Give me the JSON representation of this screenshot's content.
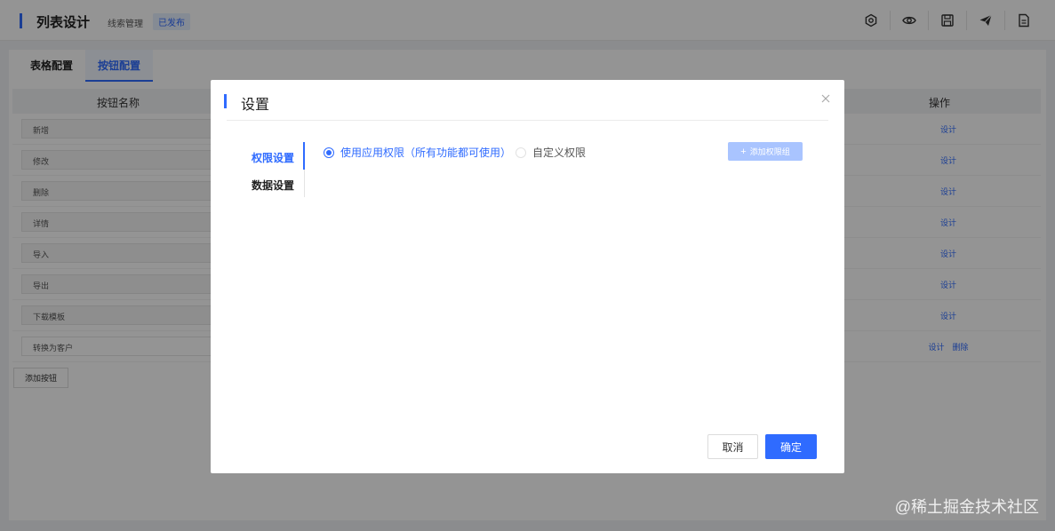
{
  "header": {
    "title": "列表设计",
    "breadcrumb": "线索管理",
    "status": "已发布",
    "tools": [
      {
        "icon": "settings-icon"
      },
      {
        "icon": "eye-icon"
      },
      {
        "icon": "save-icon"
      },
      {
        "icon": "send-icon"
      },
      {
        "icon": "document-icon"
      }
    ]
  },
  "tabs": [
    {
      "label": "表格配置",
      "active": false
    },
    {
      "label": "按钮配置",
      "active": true
    }
  ],
  "table": {
    "columns": {
      "name": "按钮名称",
      "op": "操作"
    },
    "rows": [
      {
        "name": "新增",
        "ops": [
          "设计"
        ]
      },
      {
        "name": "修改",
        "ops": [
          "设计"
        ]
      },
      {
        "name": "删除",
        "ops": [
          "设计"
        ]
      },
      {
        "name": "详情",
        "ops": [
          "设计"
        ]
      },
      {
        "name": "导入",
        "ops": [
          "设计"
        ]
      },
      {
        "name": "导出",
        "ops": [
          "设计"
        ]
      },
      {
        "name": "下载模板",
        "ops": [
          "设计"
        ]
      },
      {
        "name": "转换为客户",
        "ops": [
          "设计",
          "删除"
        ]
      }
    ],
    "add_label": "添加按钮"
  },
  "modal": {
    "title": "设置",
    "side": [
      {
        "label": "权限设置",
        "active": true
      },
      {
        "label": "数据设置",
        "active": false
      }
    ],
    "radios": {
      "app": "使用应用权限（所有功能都可使用）",
      "custom": "自定义权限",
      "selected": "app"
    },
    "add_group": "添加权限组",
    "cancel": "取消",
    "ok": "确定"
  },
  "watermark": "@稀土掘金技术社区",
  "colors": {
    "accent": "#2f6bff"
  }
}
